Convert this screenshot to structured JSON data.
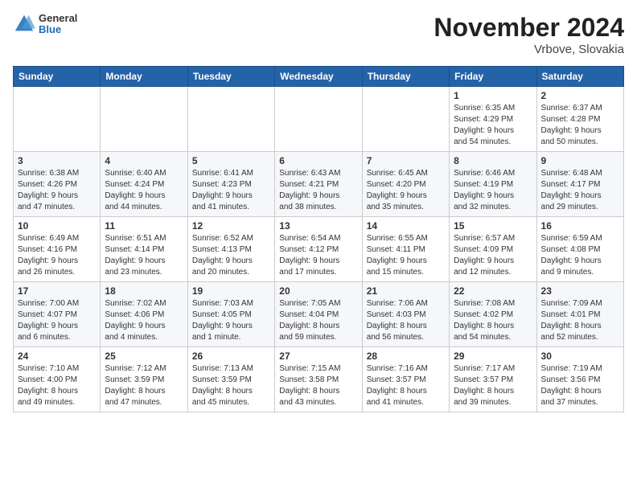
{
  "header": {
    "logo": {
      "line1": "General",
      "line2": "Blue"
    },
    "month": "November 2024",
    "location": "Vrbove, Slovakia"
  },
  "weekdays": [
    "Sunday",
    "Monday",
    "Tuesday",
    "Wednesday",
    "Thursday",
    "Friday",
    "Saturday"
  ],
  "weeks": [
    [
      {
        "day": "",
        "info": ""
      },
      {
        "day": "",
        "info": ""
      },
      {
        "day": "",
        "info": ""
      },
      {
        "day": "",
        "info": ""
      },
      {
        "day": "",
        "info": ""
      },
      {
        "day": "1",
        "info": "Sunrise: 6:35 AM\nSunset: 4:29 PM\nDaylight: 9 hours\nand 54 minutes."
      },
      {
        "day": "2",
        "info": "Sunrise: 6:37 AM\nSunset: 4:28 PM\nDaylight: 9 hours\nand 50 minutes."
      }
    ],
    [
      {
        "day": "3",
        "info": "Sunrise: 6:38 AM\nSunset: 4:26 PM\nDaylight: 9 hours\nand 47 minutes."
      },
      {
        "day": "4",
        "info": "Sunrise: 6:40 AM\nSunset: 4:24 PM\nDaylight: 9 hours\nand 44 minutes."
      },
      {
        "day": "5",
        "info": "Sunrise: 6:41 AM\nSunset: 4:23 PM\nDaylight: 9 hours\nand 41 minutes."
      },
      {
        "day": "6",
        "info": "Sunrise: 6:43 AM\nSunset: 4:21 PM\nDaylight: 9 hours\nand 38 minutes."
      },
      {
        "day": "7",
        "info": "Sunrise: 6:45 AM\nSunset: 4:20 PM\nDaylight: 9 hours\nand 35 minutes."
      },
      {
        "day": "8",
        "info": "Sunrise: 6:46 AM\nSunset: 4:19 PM\nDaylight: 9 hours\nand 32 minutes."
      },
      {
        "day": "9",
        "info": "Sunrise: 6:48 AM\nSunset: 4:17 PM\nDaylight: 9 hours\nand 29 minutes."
      }
    ],
    [
      {
        "day": "10",
        "info": "Sunrise: 6:49 AM\nSunset: 4:16 PM\nDaylight: 9 hours\nand 26 minutes."
      },
      {
        "day": "11",
        "info": "Sunrise: 6:51 AM\nSunset: 4:14 PM\nDaylight: 9 hours\nand 23 minutes."
      },
      {
        "day": "12",
        "info": "Sunrise: 6:52 AM\nSunset: 4:13 PM\nDaylight: 9 hours\nand 20 minutes."
      },
      {
        "day": "13",
        "info": "Sunrise: 6:54 AM\nSunset: 4:12 PM\nDaylight: 9 hours\nand 17 minutes."
      },
      {
        "day": "14",
        "info": "Sunrise: 6:55 AM\nSunset: 4:11 PM\nDaylight: 9 hours\nand 15 minutes."
      },
      {
        "day": "15",
        "info": "Sunrise: 6:57 AM\nSunset: 4:09 PM\nDaylight: 9 hours\nand 12 minutes."
      },
      {
        "day": "16",
        "info": "Sunrise: 6:59 AM\nSunset: 4:08 PM\nDaylight: 9 hours\nand 9 minutes."
      }
    ],
    [
      {
        "day": "17",
        "info": "Sunrise: 7:00 AM\nSunset: 4:07 PM\nDaylight: 9 hours\nand 6 minutes."
      },
      {
        "day": "18",
        "info": "Sunrise: 7:02 AM\nSunset: 4:06 PM\nDaylight: 9 hours\nand 4 minutes."
      },
      {
        "day": "19",
        "info": "Sunrise: 7:03 AM\nSunset: 4:05 PM\nDaylight: 9 hours\nand 1 minute."
      },
      {
        "day": "20",
        "info": "Sunrise: 7:05 AM\nSunset: 4:04 PM\nDaylight: 8 hours\nand 59 minutes."
      },
      {
        "day": "21",
        "info": "Sunrise: 7:06 AM\nSunset: 4:03 PM\nDaylight: 8 hours\nand 56 minutes."
      },
      {
        "day": "22",
        "info": "Sunrise: 7:08 AM\nSunset: 4:02 PM\nDaylight: 8 hours\nand 54 minutes."
      },
      {
        "day": "23",
        "info": "Sunrise: 7:09 AM\nSunset: 4:01 PM\nDaylight: 8 hours\nand 52 minutes."
      }
    ],
    [
      {
        "day": "24",
        "info": "Sunrise: 7:10 AM\nSunset: 4:00 PM\nDaylight: 8 hours\nand 49 minutes."
      },
      {
        "day": "25",
        "info": "Sunrise: 7:12 AM\nSunset: 3:59 PM\nDaylight: 8 hours\nand 47 minutes."
      },
      {
        "day": "26",
        "info": "Sunrise: 7:13 AM\nSunset: 3:59 PM\nDaylight: 8 hours\nand 45 minutes."
      },
      {
        "day": "27",
        "info": "Sunrise: 7:15 AM\nSunset: 3:58 PM\nDaylight: 8 hours\nand 43 minutes."
      },
      {
        "day": "28",
        "info": "Sunrise: 7:16 AM\nSunset: 3:57 PM\nDaylight: 8 hours\nand 41 minutes."
      },
      {
        "day": "29",
        "info": "Sunrise: 7:17 AM\nSunset: 3:57 PM\nDaylight: 8 hours\nand 39 minutes."
      },
      {
        "day": "30",
        "info": "Sunrise: 7:19 AM\nSunset: 3:56 PM\nDaylight: 8 hours\nand 37 minutes."
      }
    ]
  ]
}
